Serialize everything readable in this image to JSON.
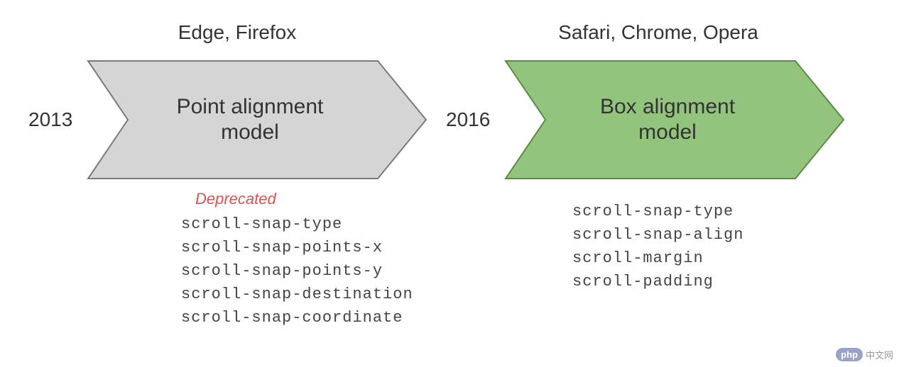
{
  "left": {
    "header": "Edge, Firefox",
    "year": "2013",
    "arrow_title_l1": "Point alignment",
    "arrow_title_l2": "model",
    "deprecated": "Deprecated",
    "props": {
      "p1": "scroll-snap-type",
      "p2": "scroll-snap-points-x",
      "p3": "scroll-snap-points-y",
      "p4": "scroll-snap-destination",
      "p5": "scroll-snap-coordinate"
    }
  },
  "right": {
    "header": "Safari, Chrome, Opera",
    "year": "2016",
    "arrow_title_l1": "Box alignment",
    "arrow_title_l2": "model",
    "props": {
      "p1": "scroll-snap-type",
      "p2": "scroll-snap-align",
      "p3": "scroll-margin",
      "p4": "scroll-padding"
    }
  },
  "watermark": {
    "php": "php",
    "text": "中文网"
  },
  "colors": {
    "left_fill": "#d5d5d5",
    "left_stroke": "#7a7a7a",
    "right_fill": "#93c47d",
    "right_stroke": "#5b8a43",
    "deprecated": "#d9534f"
  }
}
